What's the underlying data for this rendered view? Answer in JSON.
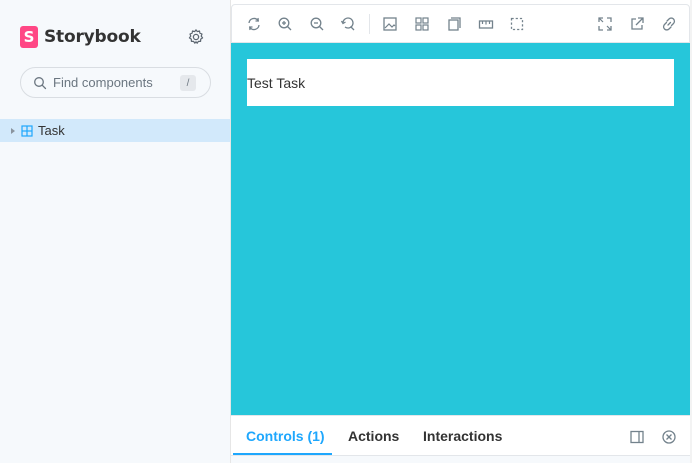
{
  "brand": {
    "name": "Storybook",
    "logo_letter": "S",
    "accent": "#ff4785"
  },
  "search": {
    "placeholder": "Find components",
    "shortcut": "/"
  },
  "sidebar": {
    "items": [
      {
        "label": "Task",
        "selected": true
      }
    ]
  },
  "toolbar": {
    "buttons": [
      "reload-icon",
      "zoom-in-icon",
      "zoom-out-icon",
      "zoom-reset-icon",
      "background-icon",
      "grid-icon",
      "viewport-icon",
      "measure-icon",
      "outline-icon",
      "fullscreen-icon",
      "open-new-tab-icon",
      "copy-link-icon"
    ]
  },
  "canvas": {
    "background": "#26c6da",
    "task_title": "Test Task"
  },
  "addons": {
    "tabs": [
      {
        "label": "Controls (1)",
        "active": true
      },
      {
        "label": "Actions",
        "active": false
      },
      {
        "label": "Interactions",
        "active": false
      }
    ],
    "accent": "#1ea7fd"
  }
}
